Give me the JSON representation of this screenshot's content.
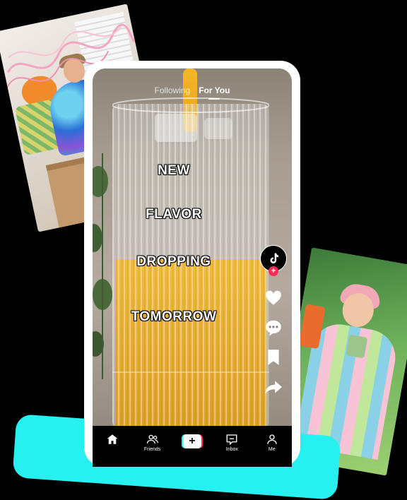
{
  "feed": {
    "tabs": [
      {
        "label": "Following",
        "active": false
      },
      {
        "label": "For You",
        "active": true
      }
    ],
    "caption_words": [
      "NEW",
      "FLAVOR",
      "DROPPING",
      "TOMORROW"
    ]
  },
  "nav": {
    "items": [
      {
        "label": "",
        "icon": "home-icon"
      },
      {
        "label": "Friends",
        "icon": "friends-icon"
      },
      {
        "label": "",
        "icon": "create-plus-icon"
      },
      {
        "label": "Inbox",
        "icon": "inbox-icon"
      },
      {
        "label": "Me",
        "icon": "profile-icon"
      }
    ]
  },
  "colors": {
    "accent_red": "#fe2c55",
    "accent_cyan": "#25f4ee",
    "background": "#000000"
  },
  "avatar": {
    "badge": "+"
  }
}
